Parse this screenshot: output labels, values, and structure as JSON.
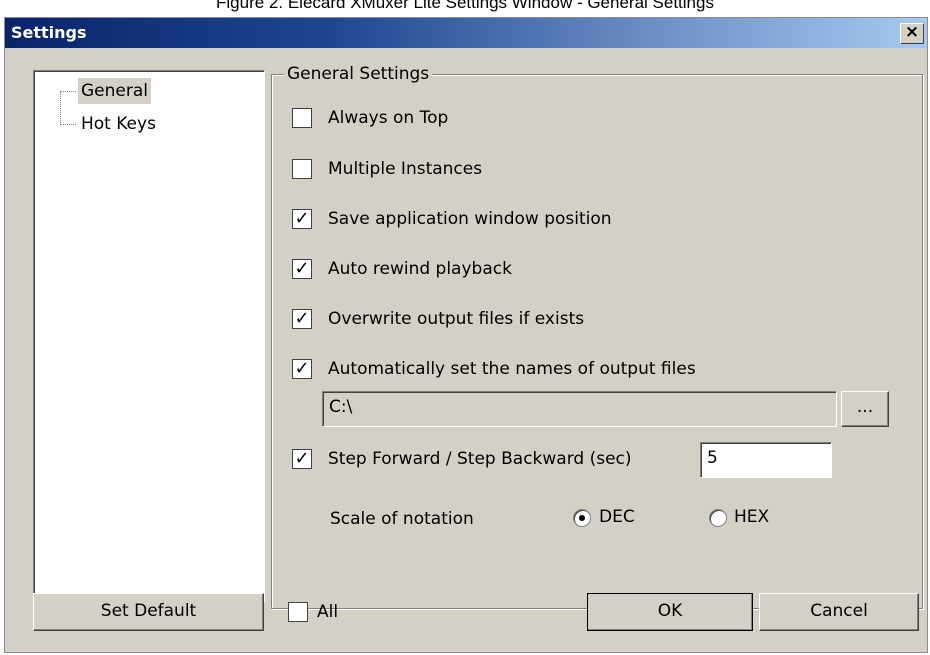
{
  "caption": "Figure 2.     Elecard XMuxer Lite Settings Window - General Settings",
  "window": {
    "title": "Settings",
    "close_glyph": "×",
    "titlebar_colors": [
      "#0a246a",
      "#a6caf0"
    ]
  },
  "tree": {
    "items": [
      {
        "label": "General",
        "selected": true
      },
      {
        "label": "Hot Keys",
        "selected": false
      }
    ]
  },
  "general_settings": {
    "group_title": "General Settings",
    "options": [
      {
        "label": "Always on Top",
        "checked": false
      },
      {
        "label": "Multiple Instances",
        "checked": false
      },
      {
        "label": "Save application window position",
        "checked": true
      },
      {
        "label": "Auto rewind playback",
        "checked": true
      },
      {
        "label": "Overwrite output files if exists",
        "checked": true
      },
      {
        "label": "Automatically set the names of output files",
        "checked": true
      }
    ],
    "output_path": "C:\\",
    "browse_label": "...",
    "step": {
      "label": "Step Forward / Step Backward (sec)",
      "checked": true,
      "value": "5"
    },
    "notation": {
      "label": "Scale of notation",
      "options": [
        {
          "label": "DEC",
          "selected": true
        },
        {
          "label": "HEX",
          "selected": false
        }
      ]
    }
  },
  "footer": {
    "set_default_label": "Set Default",
    "all_label": "All",
    "all_checked": false,
    "ok_label": "OK",
    "cancel_label": "Cancel"
  },
  "check_glyph": "✓"
}
